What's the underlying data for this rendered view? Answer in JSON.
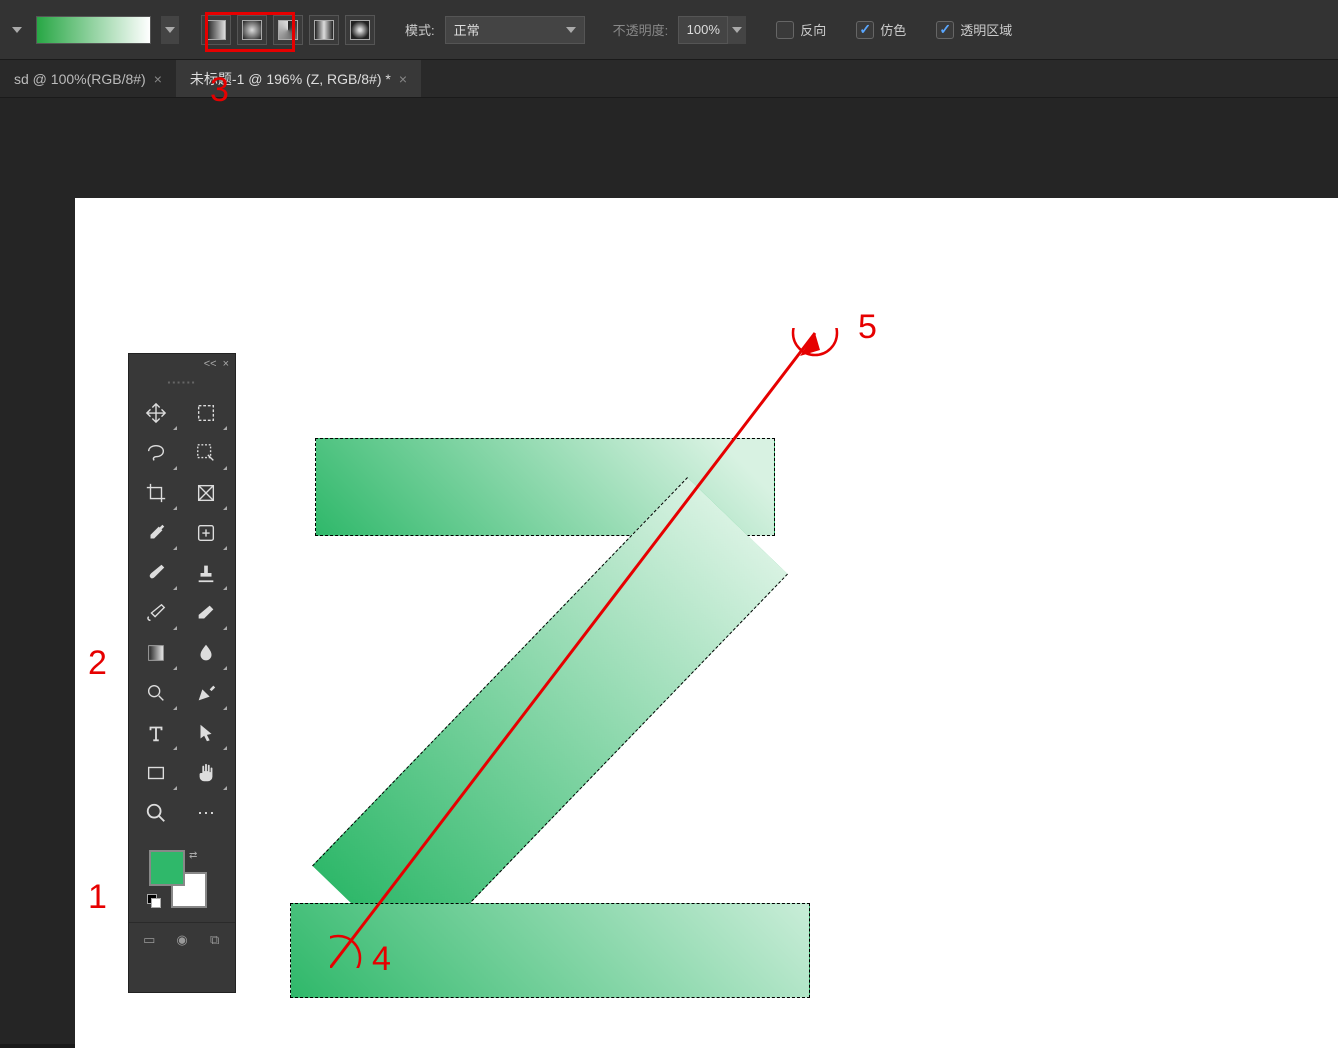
{
  "options_bar": {
    "mode_label": "模式:",
    "mode_value": "正常",
    "opacity_label": "不透明度:",
    "opacity_value": "100%",
    "reverse_label": "反向",
    "dither_label": "仿色",
    "transparency_label": "透明区域",
    "reverse_checked": false,
    "dither_checked": true,
    "transparency_checked": true,
    "gradient_colors": {
      "start": "#28a745",
      "end": "#ffffff"
    }
  },
  "tabs": [
    {
      "label": "sd @ 100%(RGB/8#)",
      "active": false
    },
    {
      "label": "未标题-1 @ 196% (Z, RGB/8#) *",
      "active": true
    }
  ],
  "toolbox": {
    "collapse": "<<",
    "tools": [
      "move-tool",
      "marquee-tool",
      "lasso-tool",
      "quick-select-tool",
      "crop-tool",
      "frame-tool",
      "eyedropper-tool",
      "healing-brush-tool",
      "brush-tool",
      "stamp-tool",
      "history-brush-tool",
      "eraser-tool",
      "gradient-tool",
      "blur-tool",
      "dodge-tool",
      "pen-tool",
      "type-tool",
      "path-select-tool",
      "rectangle-tool",
      "hand-tool",
      "zoom-tool",
      "more-tool"
    ],
    "foreground_color": "#2fb86a",
    "background_color": "#ffffff"
  },
  "annotations": {
    "n1": "1",
    "n2": "2",
    "n3": "3",
    "n4": "4",
    "n5": "5"
  }
}
